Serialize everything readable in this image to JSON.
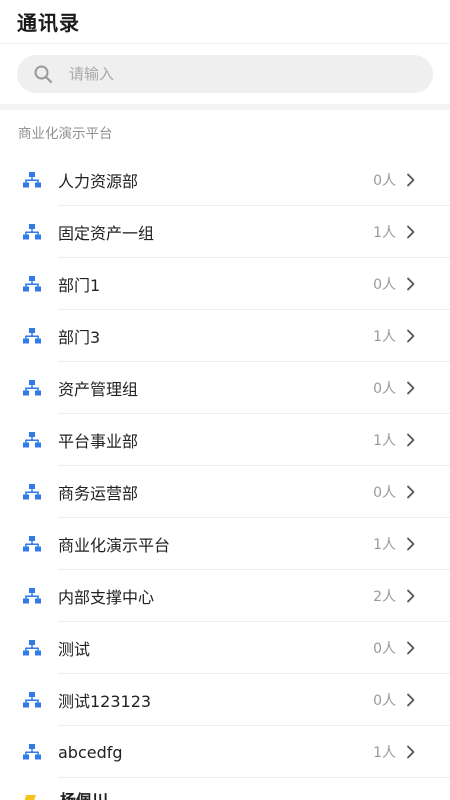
{
  "header": {
    "title": "通讯录"
  },
  "search": {
    "placeholder": "请输入"
  },
  "section": {
    "label": "商业化演示平台"
  },
  "departments": [
    {
      "name": "人力资源部",
      "count": "0人"
    },
    {
      "name": "固定资产一组",
      "count": "1人"
    },
    {
      "name": "部门1",
      "count": "0人"
    },
    {
      "name": "部门3",
      "count": "1人"
    },
    {
      "name": "资产管理组",
      "count": "0人"
    },
    {
      "name": "平台事业部",
      "count": "1人"
    },
    {
      "name": "商务运营部",
      "count": "0人"
    },
    {
      "name": "商业化演示平台",
      "count": "1人"
    },
    {
      "name": "内部支撑中心",
      "count": "2人"
    },
    {
      "name": "测试",
      "count": "0人"
    },
    {
      "name": "测试123123",
      "count": "0人"
    },
    {
      "name": "abcedfg",
      "count": "1人"
    }
  ],
  "person": {
    "name": "杨佩川"
  },
  "icons": {
    "search": "search-icon",
    "department": "org-structure-icon",
    "chevron": "chevron-right-icon",
    "avatar": "user-avatar-icon"
  },
  "colors": {
    "accent": "#2f7ce8",
    "avatar": "#f4c419"
  }
}
